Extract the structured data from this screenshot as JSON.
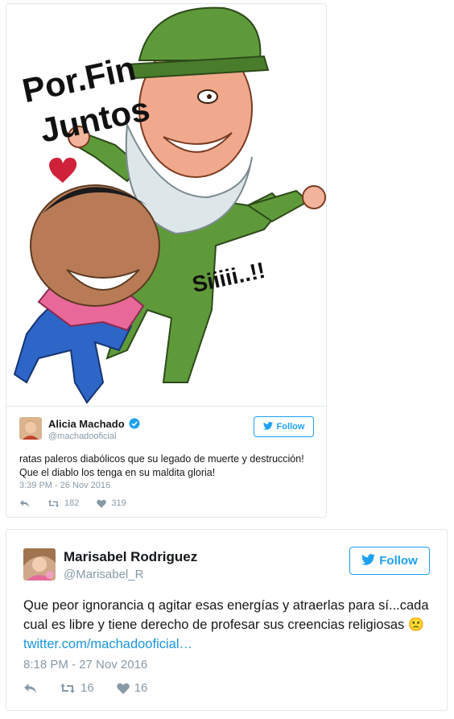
{
  "tweet1": {
    "image": {
      "caption_top": [
        "Por.Fin",
        "Juntos"
      ],
      "caption_side": "Siiiii..!!"
    },
    "author_name": "Alicia Machado",
    "author_handle": "@machadooficial",
    "follow_label": "Follow",
    "text_line1": "ratas paleros diabólicos que su legado de muerte y destrucción!",
    "text_line2": "Que el diablo los tenga en su maldita gloria!",
    "timestamp": "3:39 PM - 26 Nov 2016",
    "retweets": "182",
    "likes": "319"
  },
  "tweet2": {
    "author_name": "Marisabel Rodriguez",
    "author_handle": "@Marisabel_R",
    "follow_label": "Follow",
    "text_main": "Que peor ignorancia q agitar esas energías y atraerlas para sí...cada cual es libre y tiene derecho de profesar sus creencias religiosas ",
    "emoji": "🙁",
    "link": "twitter.com/machadooficial…",
    "timestamp": "8:18 PM - 27 Nov 2016",
    "retweets": "16",
    "likes": "16"
  },
  "colors": {
    "accent": "#1da1f2",
    "link": "#1b95e0",
    "muted": "#8899a6",
    "border": "#e1e8ed"
  },
  "icons": [
    "reply-icon",
    "retweet-icon",
    "heart-icon",
    "twitter-bird-icon",
    "verified-badge-icon"
  ]
}
